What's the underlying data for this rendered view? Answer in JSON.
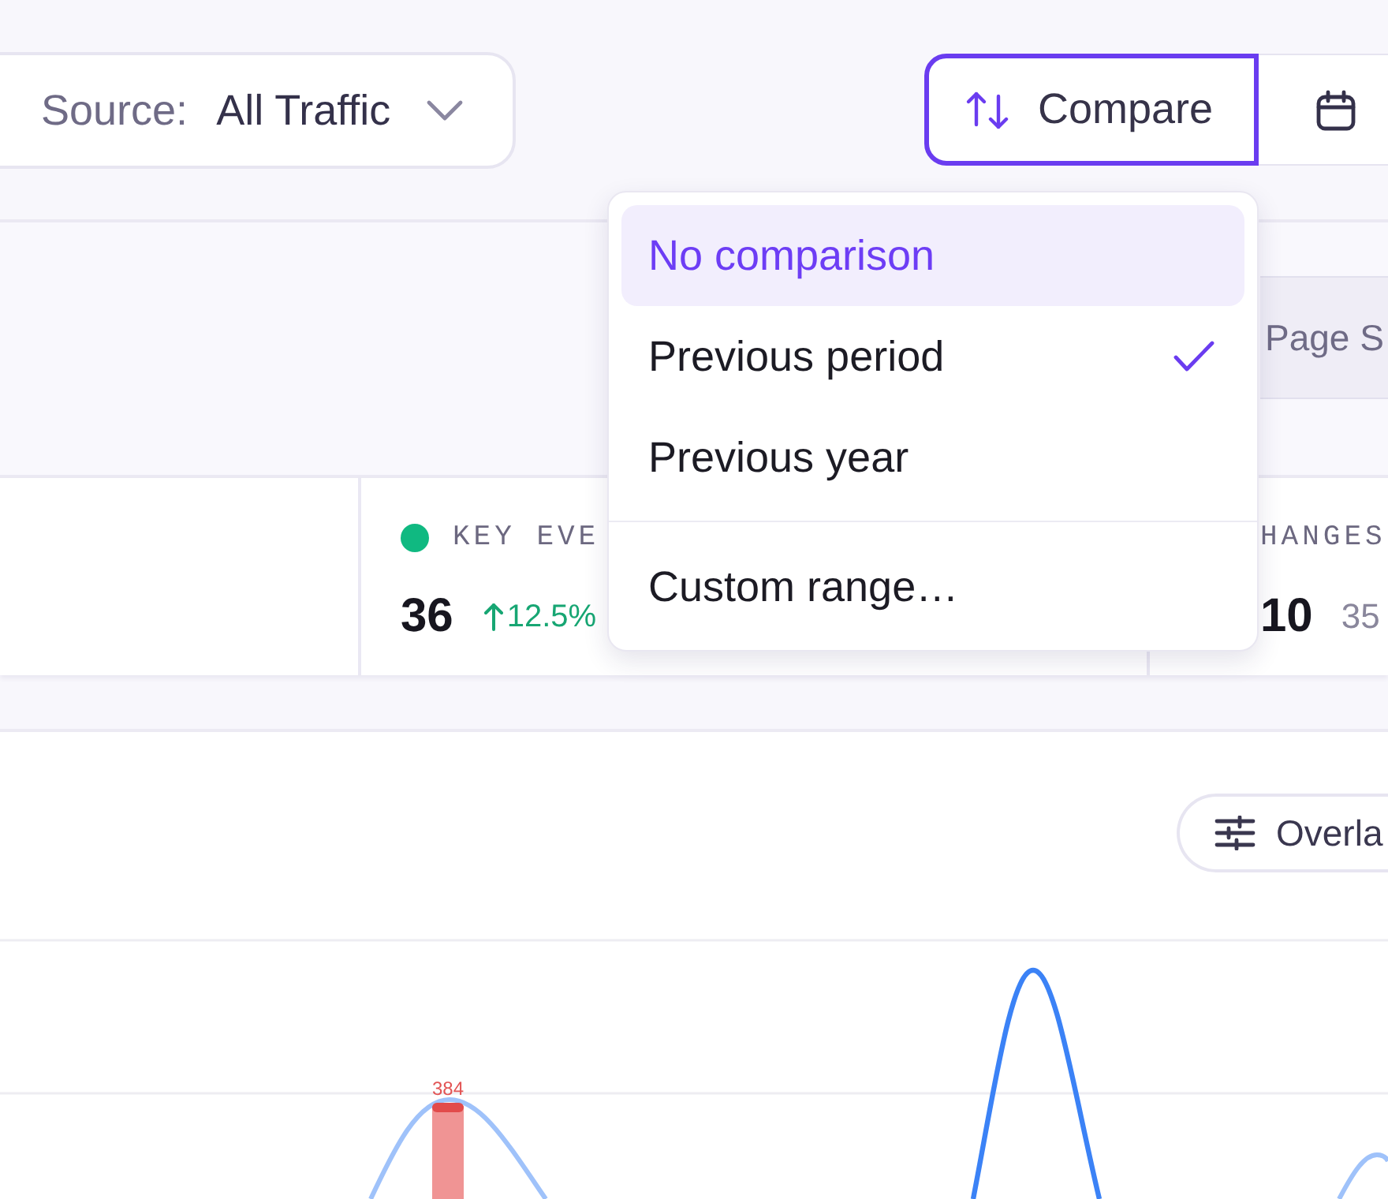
{
  "toolbar": {
    "source": {
      "label": "Source:",
      "value": "All Traffic"
    },
    "compare": {
      "label": "Compare",
      "active": true
    }
  },
  "segment_tab": {
    "label": "Page S"
  },
  "metrics": [
    {
      "label": "KEY EVE",
      "color": "#10b981",
      "value": "36",
      "change": "12.5%",
      "increase": true
    },
    {
      "label": "HANGES",
      "value": "10",
      "secondary": "35"
    }
  ],
  "overlay_button": {
    "label": "Overla"
  },
  "chart": {
    "bar_label": "384"
  },
  "menu": {
    "sections": [
      {
        "items": [
          {
            "label": "No comparison",
            "highlighted": true,
            "selected": false
          },
          {
            "label": "Previous period",
            "highlighted": false,
            "selected": true
          },
          {
            "label": "Previous year",
            "highlighted": false,
            "selected": false
          }
        ]
      },
      {
        "items": [
          {
            "label": "Custom range…",
            "highlighted": false,
            "selected": false
          }
        ]
      }
    ]
  }
}
